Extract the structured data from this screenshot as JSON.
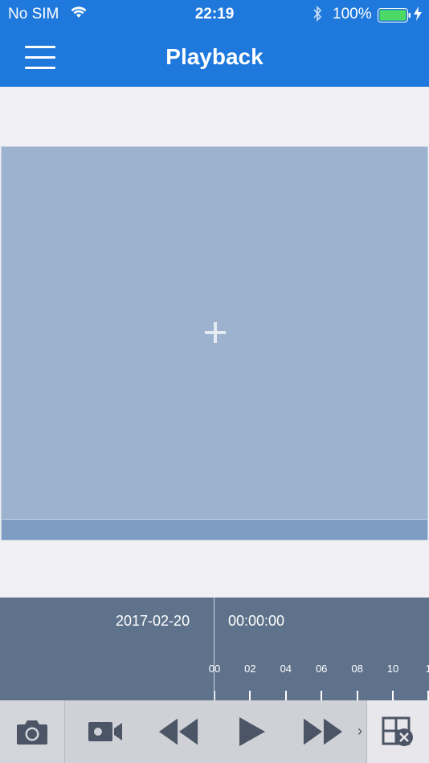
{
  "status_bar": {
    "carrier": "No SIM",
    "time": "22:19",
    "battery_percent": "100%",
    "battery_level": 1.0,
    "icons": [
      "wifi-icon",
      "bluetooth-icon",
      "battery-icon",
      "charging-icon"
    ]
  },
  "navbar": {
    "title": "Playback",
    "menu_icon": "hamburger-menu-icon"
  },
  "video": {
    "add_icon": "plus-icon"
  },
  "timeline": {
    "date": "2017-02-20",
    "time": "00:00:00",
    "hour_labels": [
      "00",
      "02",
      "04",
      "06",
      "08",
      "10",
      "1"
    ]
  },
  "toolbar": {
    "buttons": [
      "snapshot-camera-icon",
      "record-video-icon",
      "rewind-icon",
      "play-icon",
      "fast-forward-icon",
      "close-window-icon"
    ],
    "more_arrow": "›"
  },
  "colors": {
    "accent": "#1f78dc",
    "video_bg": "#9cb2cf",
    "timeline_bg": "#5f728c",
    "toolbar_bg": "#d4d5da",
    "icon": "#4c5565"
  }
}
